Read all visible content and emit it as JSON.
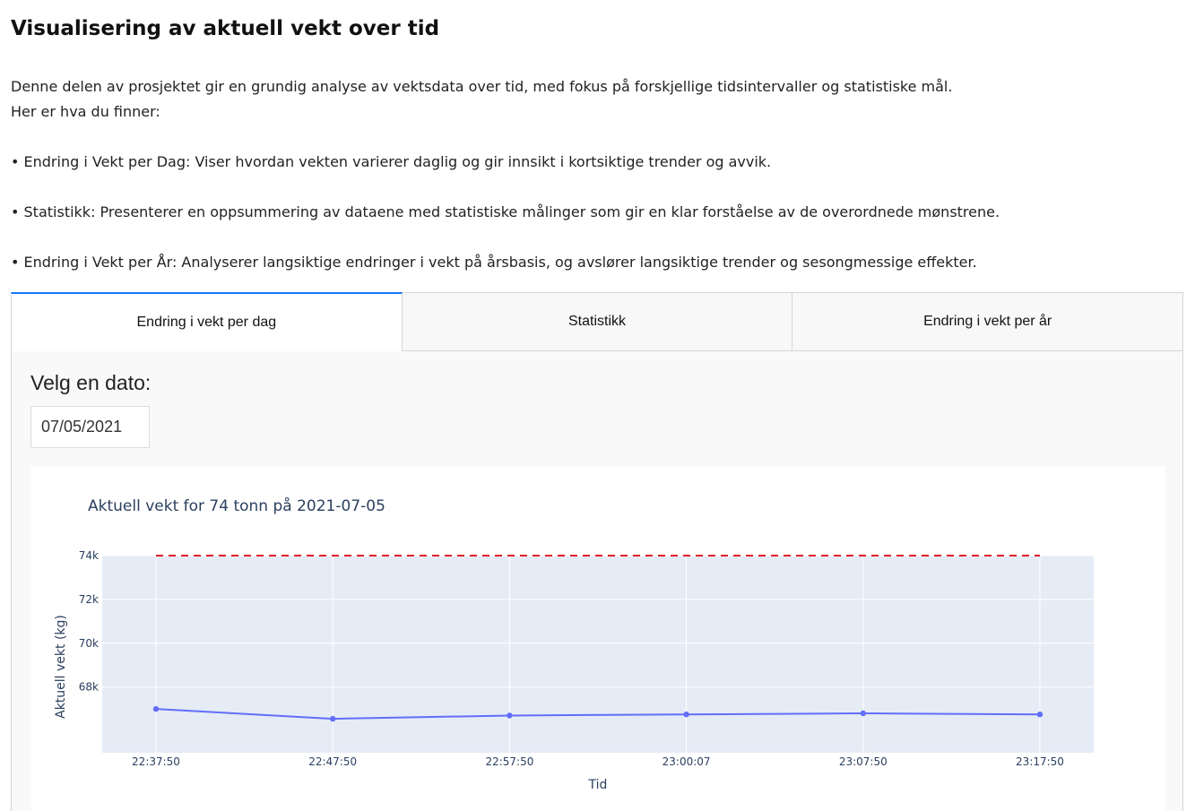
{
  "page": {
    "title": "Visualisering av aktuell vekt over tid",
    "intro_line1": "Denne delen av prosjektet gir en grundig analyse av vektsdata over tid, med fokus på forskjellige tidsintervaller og statistiske mål.",
    "intro_line2": "Her er hva du finner:",
    "bullets": [
      "• Endring i Vekt per Dag: Viser hvordan vekten varierer daglig og gir innsikt i kortsiktige trender og avvik.",
      "• Statistikk: Presenterer en oppsummering av dataene med statistiske målinger som gir en klar forståelse av de overordnede mønstrene.",
      "• Endring i Vekt per År: Analyserer langsiktige endringer i vekt på årsbasis, og avslører langsiktige trender og sesongmessige effekter."
    ]
  },
  "tabs": [
    {
      "label": "Endring i vekt per dag",
      "active": true
    },
    {
      "label": "Statistikk",
      "active": false
    },
    {
      "label": "Endring i vekt per år",
      "active": false
    }
  ],
  "date_picker": {
    "label": "Velg en dato:",
    "value": "07/05/2021"
  },
  "colors": {
    "accent": "#1975fa",
    "series_line": "#636efa",
    "reference_line": "#e3202a",
    "plot_bg": "#e5ecf6"
  },
  "chart_data": {
    "type": "line",
    "title": "Aktuell vekt for 74 tonn på 2021-07-05",
    "xlabel": "Tid",
    "ylabel": "Aktuell vekt (kg)",
    "x": [
      "22:37:50",
      "22:47:50",
      "22:57:50",
      "23:00:07",
      "23:07:50",
      "23:17:50"
    ],
    "series": [
      {
        "values": [
          67000,
          66550,
          66700,
          66750,
          66800,
          66750
        ]
      },
      {
        "values": [
          74000,
          74000,
          74000,
          74000,
          74000,
          74000
        ],
        "style": "dashed"
      }
    ],
    "ylim": [
      65000,
      74000
    ],
    "yticks": [
      68000,
      70000,
      72000,
      74000
    ],
    "ytick_labels": [
      "68k",
      "70k",
      "72k",
      "74k"
    ],
    "grid": true
  }
}
